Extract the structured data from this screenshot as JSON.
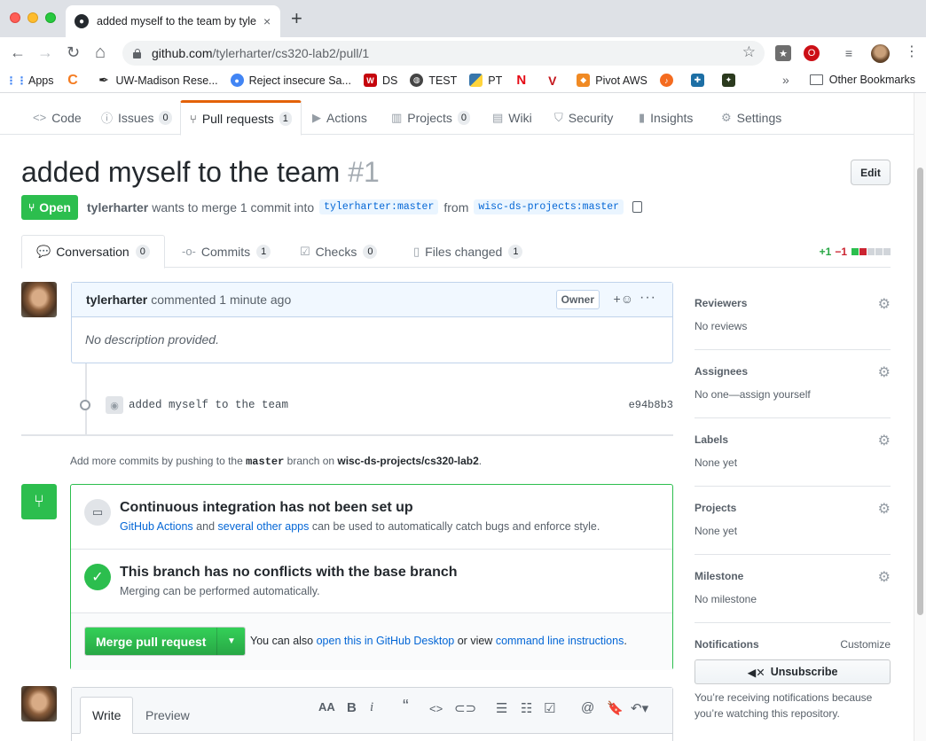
{
  "browser": {
    "tab_title": "added myself to the team by tyle",
    "tab_close": "×",
    "new_tab": "+",
    "back": "←",
    "forward": "→",
    "reload": "↻",
    "home": "⌂",
    "url_host": "github.com",
    "url_path": "/tylerharter/cs320-lab2/pull/1",
    "star": "☆",
    "menu": "⋮"
  },
  "bookmarks": {
    "items": [
      {
        "label": "Apps",
        "icon": "apps-grid-icon",
        "color": "#4285f4"
      },
      {
        "label": "",
        "icon": "orange-c-icon",
        "color": "#f47b20"
      },
      {
        "label": "UW-Madison Rese...",
        "icon": "pen-nib-icon",
        "color": "#222222"
      },
      {
        "label": "Reject insecure Sa...",
        "icon": "chrome-icon",
        "color": "#4285f4"
      },
      {
        "label": "DS",
        "icon": "uw-crest-icon",
        "color": "#c5050c"
      },
      {
        "label": "TEST",
        "icon": "globe-icon",
        "color": "#444444"
      },
      {
        "label": "PT",
        "icon": "python-icon",
        "color": "#3776ab"
      },
      {
        "label": "",
        "icon": "netflix-icon",
        "color": "#e50914"
      },
      {
        "label": "",
        "icon": "v-icon",
        "color": "#c4161c"
      },
      {
        "label": "Pivot AWS",
        "icon": "aws-box-icon",
        "color": "#f08a24"
      },
      {
        "label": "",
        "icon": "music-icon",
        "color": "#f46b1f"
      },
      {
        "label": "",
        "icon": "cross-icon",
        "color": "#1d6fa5"
      },
      {
        "label": "",
        "icon": "badge-icon",
        "color": "#2b3a1e"
      }
    ],
    "overflow": "»",
    "other": "Other Bookmarks"
  },
  "repo_nav": {
    "code": "Code",
    "issues": "Issues",
    "issues_count": "0",
    "pulls": "Pull requests",
    "pulls_count": "1",
    "actions": "Actions",
    "projects": "Projects",
    "projects_count": "0",
    "wiki": "Wiki",
    "security": "Security",
    "insights": "Insights",
    "settings": "Settings"
  },
  "pr": {
    "title": "added myself to the team",
    "number": "#1",
    "edit_label": "Edit",
    "state": "Open",
    "author": "tylerharter",
    "meta_text": "wants to merge 1 commit into",
    "base_branch": "tylerharter:master",
    "from_text": "from",
    "head_branch": "wisc-ds-projects:master"
  },
  "pr_tabs": {
    "conversation": "Conversation",
    "conversation_count": "0",
    "commits": "Commits",
    "commits_count": "1",
    "checks": "Checks",
    "checks_count": "0",
    "files": "Files changed",
    "files_count": "1",
    "additions": "+1",
    "deletions": "−1"
  },
  "comment": {
    "author": "tylerharter",
    "action": "commented 1 minute ago",
    "role": "Owner",
    "reaction": "+☺",
    "more": "···",
    "body": "No description provided."
  },
  "commit": {
    "message": "added myself to the team",
    "sha": "e94b8b3"
  },
  "push_hint": {
    "prefix": "Add more commits by pushing to the",
    "branch": "master",
    "middle": "branch on",
    "repo": "wisc-ds-projects/cs320-lab2",
    "suffix": "."
  },
  "merge": {
    "ci_title": "Continuous integration has not been set up",
    "ci_link1": "GitHub Actions",
    "ci_and": "and",
    "ci_link2": "several other apps",
    "ci_rest": "can be used to automatically catch bugs and enforce style.",
    "conflict_title": "This branch has no conflicts with the base branch",
    "conflict_sub": "Merging can be performed automatically.",
    "merge_button": "Merge pull request",
    "note_prefix": "You can also",
    "note_link1": "open this in GitHub Desktop",
    "note_mid": "or view",
    "note_link2": "command line instructions",
    "note_suffix": "."
  },
  "form": {
    "write_tab": "Write",
    "preview_tab": "Preview"
  },
  "sidebar": {
    "reviewers_title": "Reviewers",
    "reviewers_value": "No reviews",
    "assignees_title": "Assignees",
    "assignees_value": "No one—assign yourself",
    "labels_title": "Labels",
    "labels_value": "None yet",
    "projects_title": "Projects",
    "projects_value": "None yet",
    "milestone_title": "Milestone",
    "milestone_value": "No milestone",
    "notifications_title": "Notifications",
    "customize": "Customize",
    "unsubscribe": "Unsubscribe",
    "notif_note": "You’re receiving notifications because you’re watching this repository."
  },
  "colors": {
    "accent_green": "#2cbe4e",
    "link_blue": "#0366d6",
    "tab_orange": "#e36209"
  }
}
